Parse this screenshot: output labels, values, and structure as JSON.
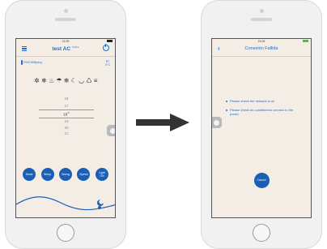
{
  "left": {
    "status_time": "21:09",
    "title": "test AC",
    "title_sup": "Online",
    "mode_label": "PM2.5Wiping",
    "rt_label": "RT",
    "rt_value": "0°C",
    "mode_icons": [
      "✲",
      "❄",
      "♨",
      "☂",
      "❄",
      "☾",
      "◡",
      "♺",
      "≡"
    ],
    "temps": [
      "16",
      "17",
      "18",
      "19",
      "20",
      "21"
    ],
    "temp_selected_unit": "°C",
    "buttons": [
      {
        "label": "Mode"
      },
      {
        "label": "Sleep"
      },
      {
        "label": "Swing"
      },
      {
        "label": "Speed"
      },
      {
        "label": "Light\nON"
      }
    ],
    "accent_color": "#1b5fb5"
  },
  "right": {
    "status_time": "21:09",
    "title": "Conexión Fallida",
    "messages": [
      "Please check the network is ok",
      "Please check air conditioners connect to the power"
    ],
    "cancel_label": "Cancel"
  }
}
